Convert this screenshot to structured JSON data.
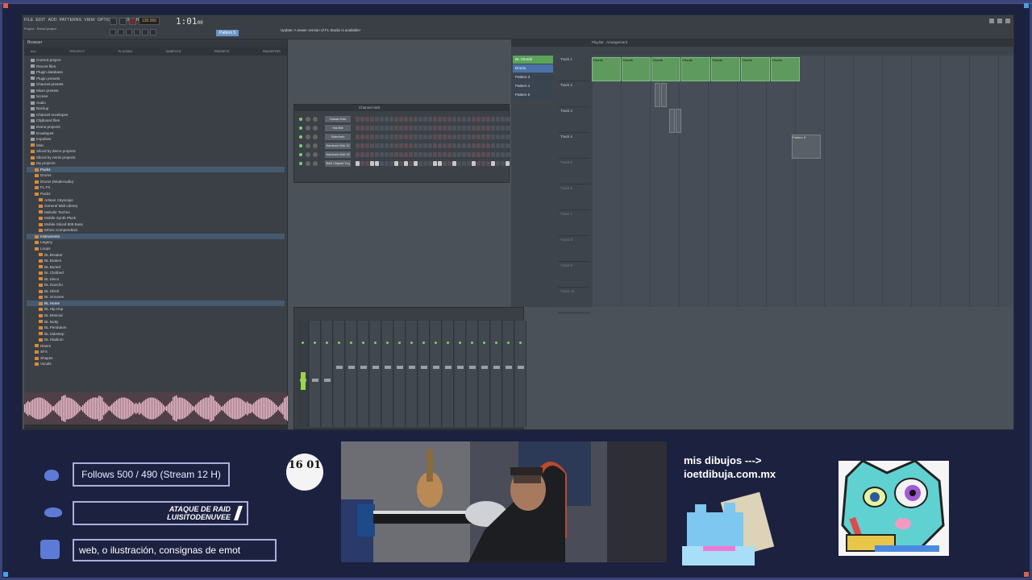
{
  "colors": {
    "frame": "#1c2140",
    "accent": "#a9b0d8",
    "fl_bg": "#4a5159",
    "clip_green": "#5e9a5e"
  },
  "fl": {
    "menu": [
      "FILE",
      "EDIT",
      "ADD",
      "PATTERNS",
      "VIEW",
      "OPTIONS",
      "TOOLS",
      "HELP"
    ],
    "hint": "Project - Bread project",
    "tempo": "130.000",
    "time": "1:01",
    "time_sub": "00",
    "pattern": "Pattern 5",
    "news": "Update: A newer version of FL Studio is available!",
    "browser_title": "Browser",
    "browser_tabs": [
      "ALL",
      "PROJECT",
      "PLUGINS",
      "SAMPLES",
      "PRESETS",
      "FAVORITES"
    ],
    "tree": [
      {
        "label": "Current project",
        "icon": "folder"
      },
      {
        "label": "Recent files",
        "icon": "folder"
      },
      {
        "label": "Plugin database",
        "icon": "folder"
      },
      {
        "label": "Plugin presets",
        "icon": "folder"
      },
      {
        "label": "Channel presets",
        "icon": "folder"
      },
      {
        "label": "Mixer presets",
        "icon": "folder"
      },
      {
        "label": "Scores",
        "icon": "folder"
      },
      {
        "label": "Audio",
        "icon": "folder"
      },
      {
        "label": "Backup",
        "icon": "folder"
      },
      {
        "label": "Channel envelopes",
        "icon": "folder"
      },
      {
        "label": "Clipboard files",
        "icon": "folder"
      },
      {
        "label": "Demo projects",
        "icon": "folder"
      },
      {
        "label": "Envelopes",
        "icon": "folder"
      },
      {
        "label": "Impulses",
        "icon": "folder"
      },
      {
        "label": "Misc",
        "icon": "folder"
      },
      {
        "label": "Sliced by demo projects",
        "icon": "folder"
      },
      {
        "label": "Sliced by remix projects",
        "icon": "folder"
      },
      {
        "label": "My projects",
        "icon": "folder"
      },
      {
        "label": "Packs",
        "icon": "folder",
        "hl": true
      },
      {
        "label": "Drums",
        "icon": "folder"
      },
      {
        "label": "Drums (ModeAudio)",
        "icon": "folder"
      },
      {
        "label": "FL FX",
        "icon": "folder"
      },
      {
        "label": "Packs",
        "icon": "folder"
      },
      {
        "label": "Artisan Cityscape",
        "icon": "folder"
      },
      {
        "label": "General Midi Library",
        "icon": "folder"
      },
      {
        "label": "Melodic Techno",
        "icon": "folder"
      },
      {
        "label": "Mobile Synth Pluck",
        "icon": "folder"
      },
      {
        "label": "Mobile Sliced 808 Bass",
        "icon": "folder"
      },
      {
        "label": "Ethnic Compendium",
        "icon": "folder"
      },
      {
        "label": "Instruments",
        "icon": "folder",
        "hl": true
      },
      {
        "label": "Legacy",
        "icon": "folder"
      },
      {
        "label": "Loops",
        "icon": "folder"
      },
      {
        "label": "BL Breaker",
        "icon": "folder"
      },
      {
        "label": "BL Broken",
        "icon": "folder"
      },
      {
        "label": "BL Buried",
        "icon": "folder"
      },
      {
        "label": "BL Clubbed",
        "icon": "folder"
      },
      {
        "label": "BL Disco",
        "icon": "folder"
      },
      {
        "label": "BL Gaucho",
        "icon": "folder"
      },
      {
        "label": "BL Glitch",
        "icon": "folder"
      },
      {
        "label": "BL Grooves",
        "icon": "folder"
      },
      {
        "label": "BL Home",
        "icon": "folder",
        "hl": true
      },
      {
        "label": "BL Hip Hop",
        "icon": "folder"
      },
      {
        "label": "BL Minimal",
        "icon": "folder"
      },
      {
        "label": "BL Nutty",
        "icon": "folder"
      },
      {
        "label": "BL Pendulum",
        "icon": "folder"
      },
      {
        "label": "BL Sidestep",
        "icon": "folder"
      },
      {
        "label": "BL Stadium",
        "icon": "folder"
      },
      {
        "label": "Risers",
        "icon": "folder"
      },
      {
        "label": "SFX",
        "icon": "folder"
      },
      {
        "label": "Shapes",
        "icon": "folder"
      },
      {
        "label": "Vocals",
        "icon": "folder"
      }
    ],
    "rack_title": "Channel rack",
    "rack_rows": [
      "Classic Kick",
      "Hat 8bit",
      "Sidechain",
      "Hardcore Kick 12",
      "Hardcore Kick 13",
      "BAD Chipset Tuq"
    ],
    "playlist_title": "Playlist - Arrangement",
    "patterns": [
      "BL Chords",
      "Drums",
      "Pattern 3",
      "Pattern 4",
      "Pattern 5"
    ],
    "tracks": [
      "Track 1",
      "Track 2",
      "Track 3",
      "Track 4",
      "Track 5",
      "Track 6",
      "Track 7",
      "Track 8",
      "Track 9",
      "Track 10"
    ],
    "clips": [
      "Chords",
      "Chords",
      "Chords",
      "Chords",
      "Chords",
      "Chords",
      "Chords"
    ],
    "clip_pattern5": "Pattern 5"
  },
  "overlay": {
    "follows": "Follows 500 / 490 (Stream 12 H)",
    "raid_line1": "ATAQUE DE RAID",
    "raid_line2": "LUISITODENUVEE",
    "ticker": "web, o ilustración, consignas de emot",
    "logo_text": "16 01",
    "promo_line1": "mis dibujos --->",
    "promo_line2": "ioetdibuja.com.mx"
  }
}
